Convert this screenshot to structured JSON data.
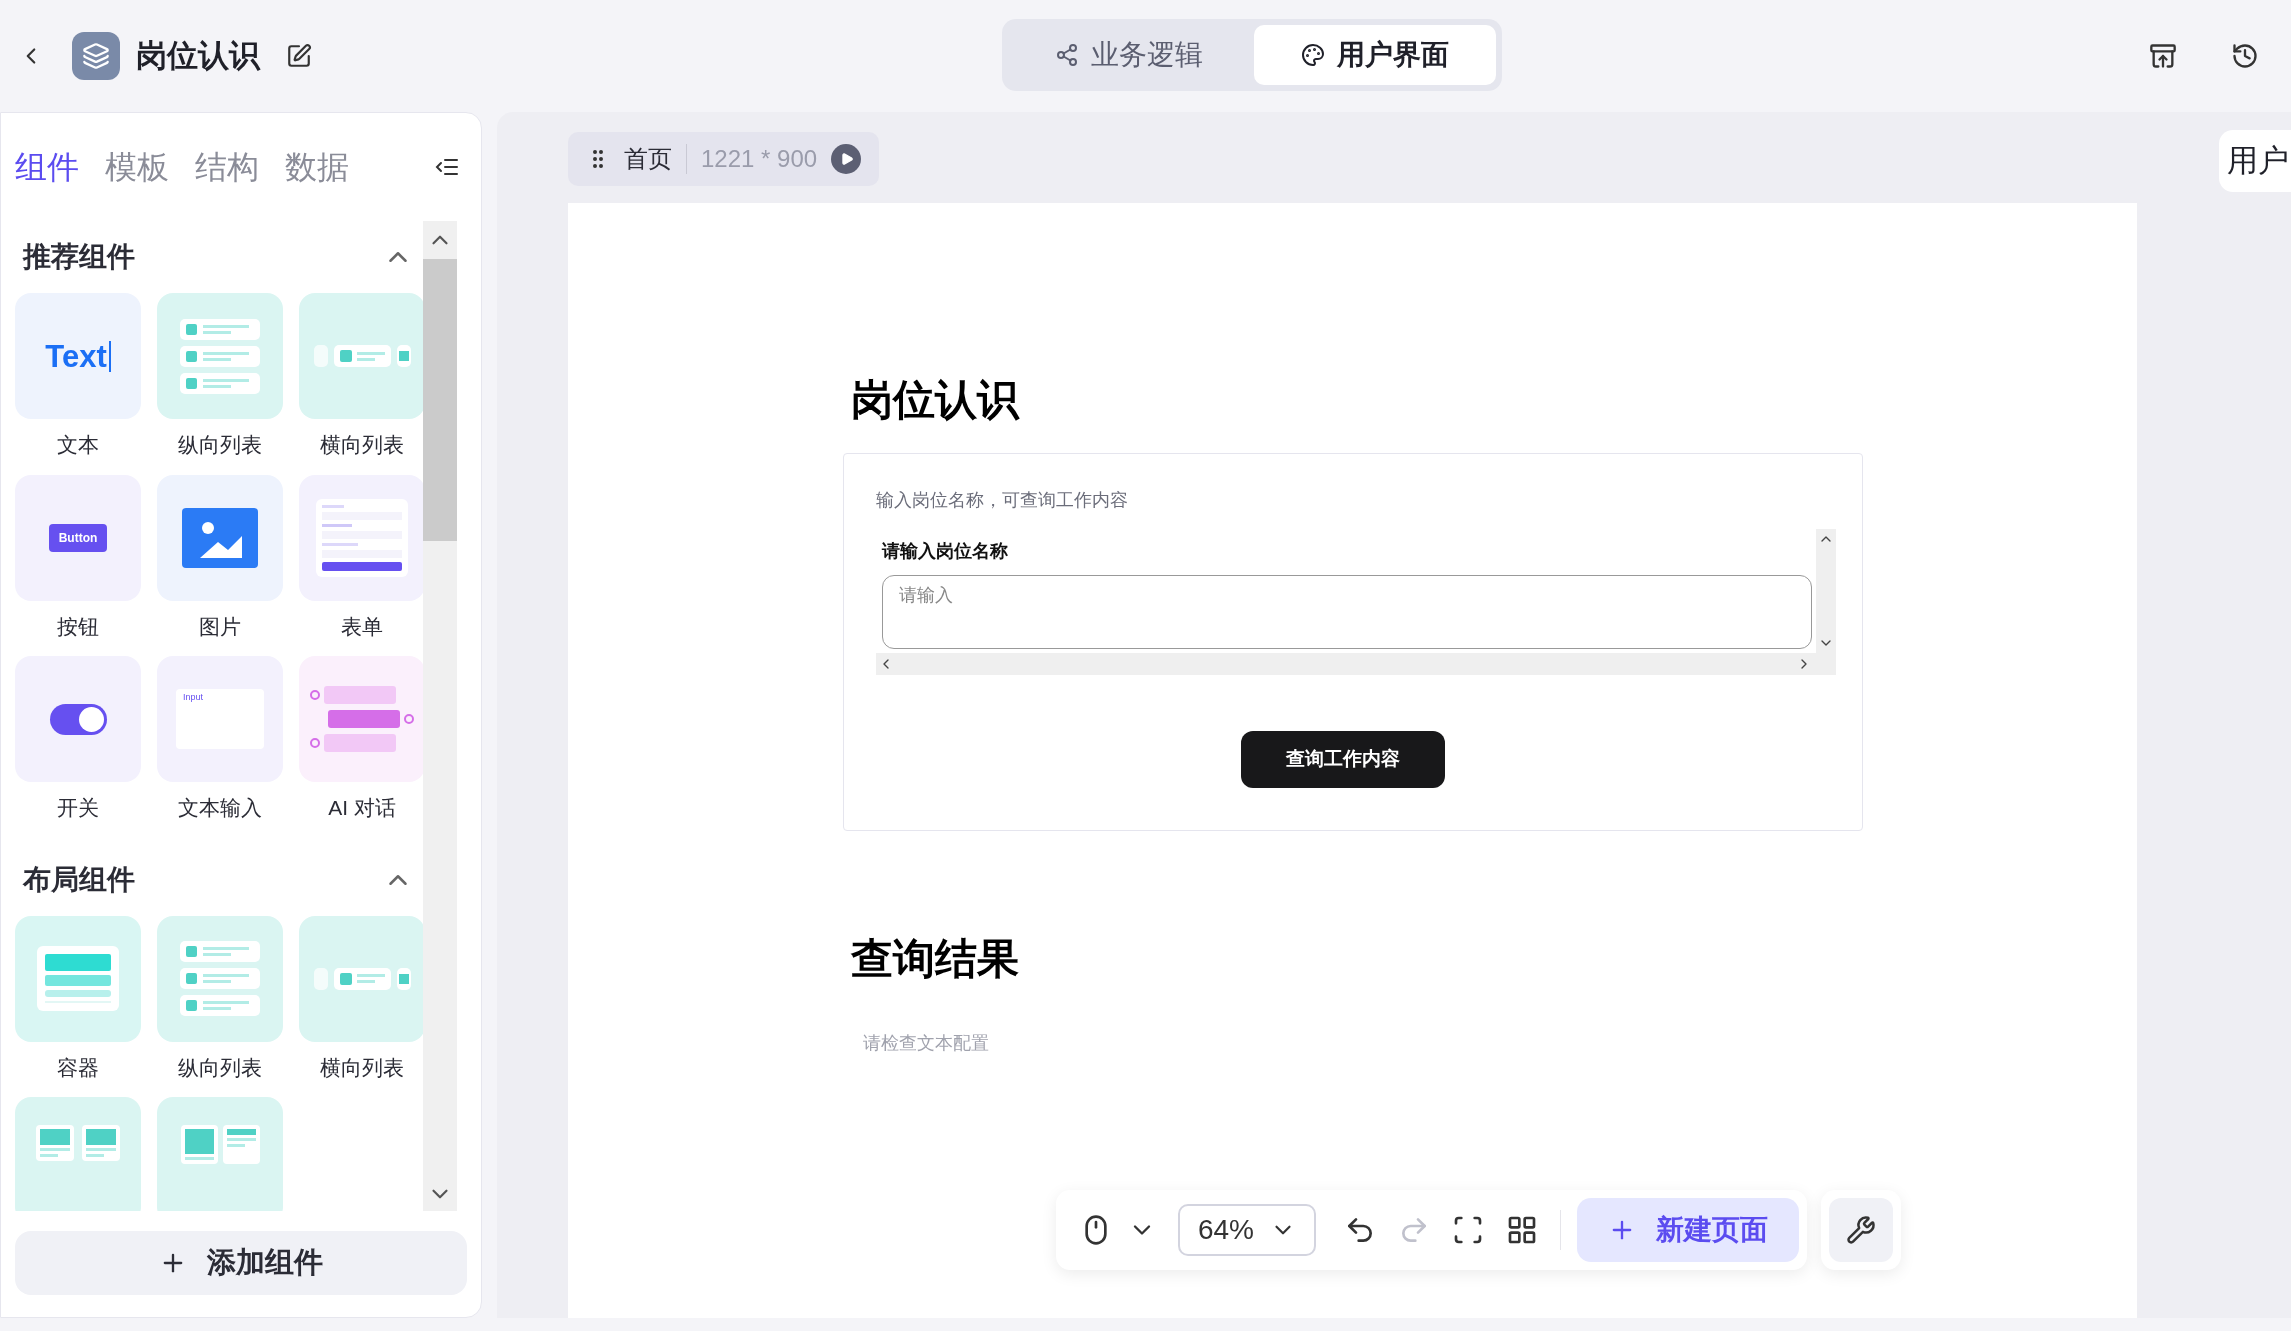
{
  "header": {
    "title": "岗位认识"
  },
  "mode_tabs": [
    {
      "kind": "logic",
      "label": "业务逻辑",
      "selected": false
    },
    {
      "kind": "ui",
      "label": "用户界面",
      "selected": true
    }
  ],
  "panel_tabs": [
    {
      "label": "组件",
      "selected": true
    },
    {
      "label": "模板",
      "selected": false
    },
    {
      "label": "结构",
      "selected": false
    },
    {
      "label": "数据",
      "selected": false
    }
  ],
  "sections": [
    {
      "title": "推荐组件",
      "expanded": true,
      "items": [
        {
          "kind": "text",
          "label": "文本",
          "preview_text": "Text"
        },
        {
          "kind": "vlist",
          "label": "纵向列表"
        },
        {
          "kind": "hlist",
          "label": "横向列表"
        },
        {
          "kind": "button",
          "label": "按钮",
          "preview_text": "Button"
        },
        {
          "kind": "image",
          "label": "图片"
        },
        {
          "kind": "form",
          "label": "表单"
        },
        {
          "kind": "switch",
          "label": "开关"
        },
        {
          "kind": "input",
          "label": "文本输入",
          "preview_text": "Input"
        },
        {
          "kind": "chat",
          "label": "AI 对话"
        }
      ]
    },
    {
      "title": "布局组件",
      "expanded": true,
      "items": [
        {
          "kind": "container",
          "label": "容器"
        },
        {
          "kind": "vlist",
          "label": "纵向列表"
        },
        {
          "kind": "hlist",
          "label": "横向列表"
        },
        {
          "kind": "grid"
        },
        {
          "kind": "split"
        }
      ]
    }
  ],
  "add_button": "添加组件",
  "page_bar": {
    "name": "首页",
    "size": "1221 * 900"
  },
  "side_tab": "用户",
  "canvas": {
    "title": "岗位认识",
    "card": {
      "caption": "输入岗位名称，可查询工作内容",
      "field_label": "请输入岗位名称",
      "placeholder": "请输入",
      "button": "查询工作内容"
    },
    "result_title": "查询结果",
    "result_text": "请检查文本配置"
  },
  "toolbar": {
    "zoom": "64%",
    "new_page": "新建页面",
    "redo_disabled": true
  }
}
